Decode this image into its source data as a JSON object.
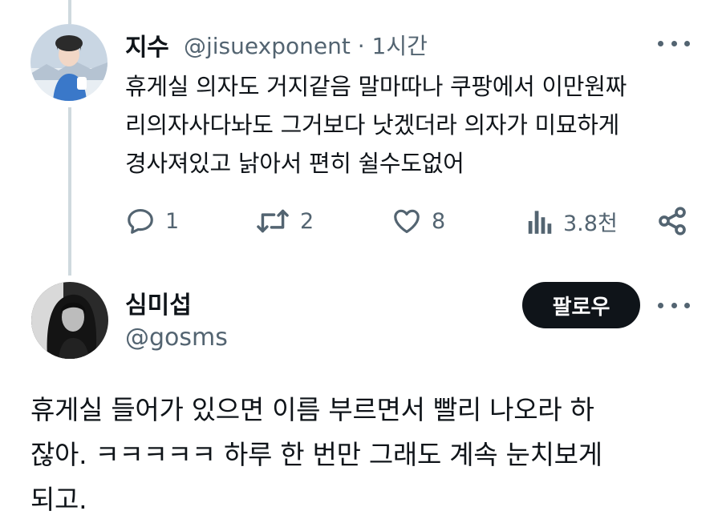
{
  "parent_tweet": {
    "display_name": "지수",
    "handle": "@jisuexponent",
    "separator": "·",
    "time": "1시간",
    "text": "휴게실 의자도 거지같음 말마따나 쿠팡에서 이만원짜\n리의자사다놔도 그거보다 낫겠더라 의자가 미묘하게\n경사져있고 낡아서 편히 쉴수도없어",
    "stats": {
      "replies": "1",
      "retweets": "2",
      "likes": "8",
      "views": "3.8천"
    }
  },
  "main_tweet": {
    "display_name": "심미섭",
    "handle": "@gosms",
    "follow_label": "팔로우",
    "text": "휴게실 들어가 있으면 이름 부르면서 빨리 나오라 하\n잖아. ㅋㅋㅋㅋㅋ 하루 한 번만 그래도 계속 눈치보게\n되고."
  },
  "icons": {
    "reply": "reply-icon",
    "retweet": "retweet-icon",
    "like": "heart-icon",
    "views": "views-icon",
    "share": "share-icon",
    "more": "more-icon"
  },
  "colors": {
    "text": "#0f1419",
    "secondary": "#536471",
    "thread_line": "#cfd9de",
    "follow_button": "#0f1419"
  }
}
